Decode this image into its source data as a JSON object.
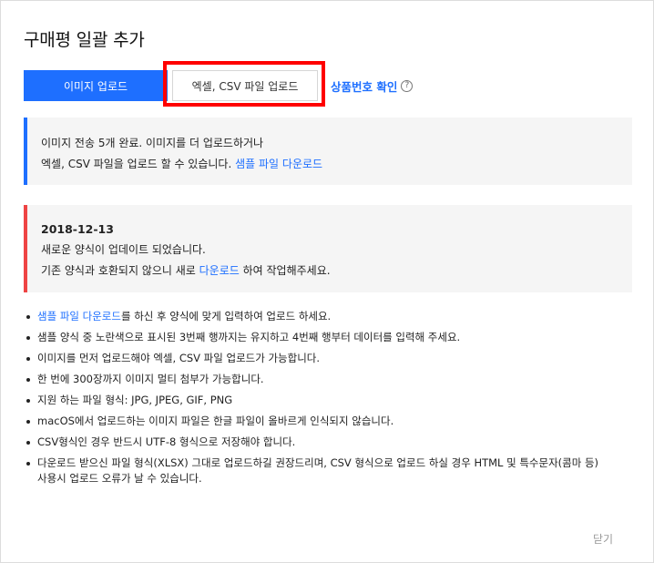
{
  "dialog": {
    "title": "구매평 일괄 추가",
    "close_label": "닫기"
  },
  "tabs": {
    "image_upload": "이미지 업로드",
    "excel_upload": "엑셀, CSV 파일 업로드"
  },
  "product_link": {
    "label": "상품번호 확인",
    "help_icon": "question-circle-icon",
    "help_glyph": "?"
  },
  "notice_blue": {
    "line1": "이미지 전송 5개 완료. 이미지를 더 업로드하거나",
    "line2_prefix": "엑셀, CSV 파일을 업로드 할 수 있습니다. ",
    "line2_link": "샘플 파일 다운로드"
  },
  "notice_red": {
    "date": "2018-12-13",
    "line1": "새로운 양식이 업데이트 되었습니다.",
    "line2_prefix": "기존 양식과 호환되지 않으니 새로 ",
    "line2_link": "다운로드",
    "line2_suffix": " 하여 작업해주세요."
  },
  "bullets": {
    "item0_link": "샘플 파일 다운로드",
    "item0_rest": "를 하신 후 양식에 맞게 입력하여 업로드 하세요.",
    "item1": "샘플 양식 중 노란색으로 표시된 3번째 행까지는 유지하고 4번째 행부터 데이터를 입력해 주세요.",
    "item2": "이미지를 먼저 업로드해야 엑셀, CSV 파일 업로드가 가능합니다.",
    "item3": "한 번에 300장까지 이미지 멀티 첨부가 가능합니다.",
    "item4": "지원 하는 파일 형식: JPG, JPEG, GIF, PNG",
    "item5": "macOS에서 업로드하는 이미지 파일은 한글 파일이 올바르게 인식되지 않습니다.",
    "item6": "CSV형식인 경우 반드시 UTF-8 형식으로 저장해야 합니다.",
    "item7_line1": "다운로드 받으신 파일 형식(XLSX) 그대로 업로드하길 권장드리며, CSV 형식으로 업로드 하실 경우 HTML 및 특수문자(콤마 등)",
    "item7_line2": "사용시 업로드 오류가 날 수 있습니다."
  },
  "colors": {
    "accent": "#1e6fff",
    "warning": "#ee4444",
    "highlight": "#ff0000"
  }
}
